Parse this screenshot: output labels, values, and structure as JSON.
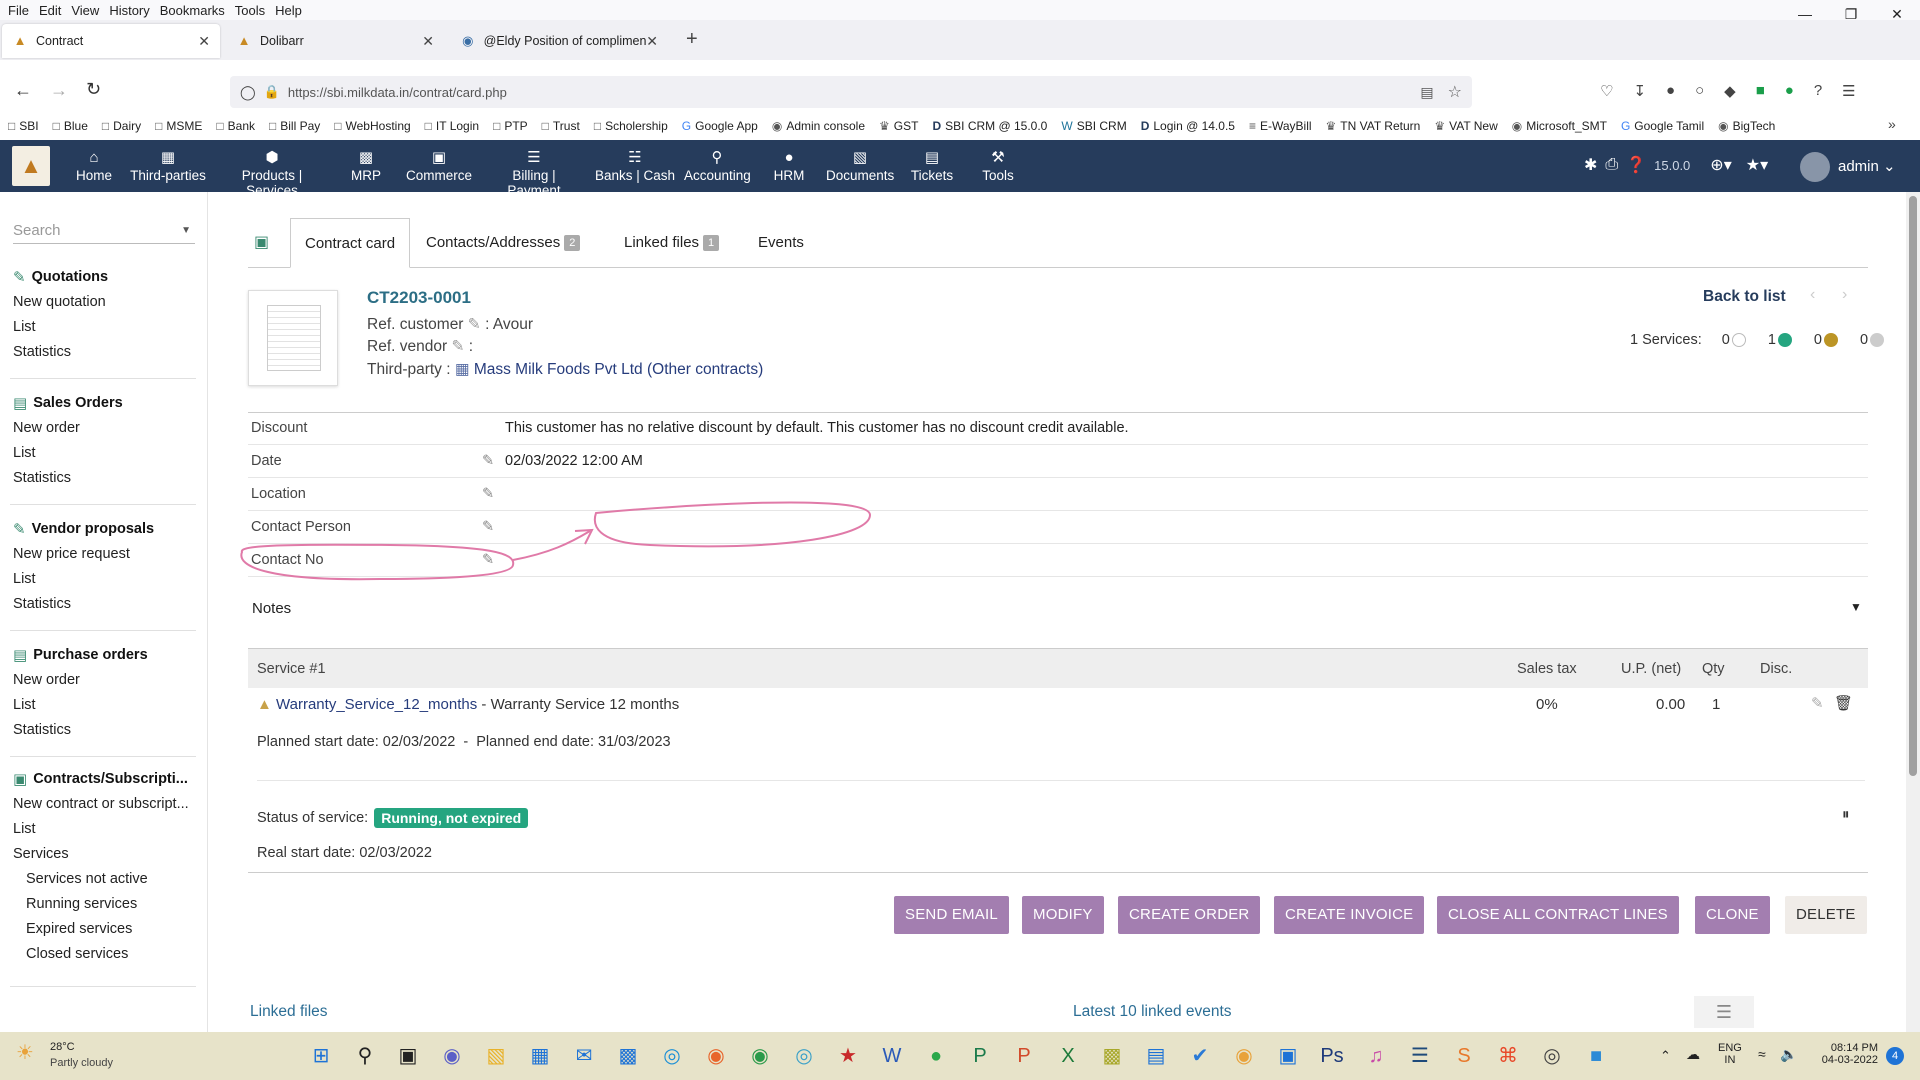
{
  "browser": {
    "menu": [
      "File",
      "Edit",
      "View",
      "History",
      "Bookmarks",
      "Tools",
      "Help"
    ],
    "tabs": [
      {
        "title": "Contract",
        "active": true
      },
      {
        "title": "Dolibarr",
        "active": false
      },
      {
        "title": "@Eldy Position of compliment",
        "active": false
      }
    ],
    "url": "https://sbi.milkdata.in/contrat/card.php",
    "bookmarks": [
      "SBI",
      "Blue",
      "Dairy",
      "MSME",
      "Bank",
      "Bill Pay",
      "WebHosting",
      "IT Login",
      "PTP",
      "Trust",
      "Scholership",
      "Google App",
      "Admin console",
      "GST",
      "SBI CRM @ 15.0.0",
      "SBI CRM",
      "Login @ 14.0.5",
      "E-WayBill",
      "TN VAT Return",
      "VAT New",
      "Microsoft_SMT",
      "Google Tamil",
      "BigTech"
    ]
  },
  "topmenu": [
    {
      "label": "Home",
      "icon": "home-icon"
    },
    {
      "label": "Third-parties",
      "icon": "building-icon"
    },
    {
      "label": "Products | Services",
      "icon": "cube-icon"
    },
    {
      "label": "MRP",
      "icon": "cubes-icon"
    },
    {
      "label": "Commerce",
      "icon": "suitcase-icon",
      "active": true
    },
    {
      "label": "Billing | Payment",
      "icon": "money-icon"
    },
    {
      "label": "Banks | Cash",
      "icon": "bank-icon"
    },
    {
      "label": "Accounting",
      "icon": "search-dollar-icon"
    },
    {
      "label": "HRM",
      "icon": "user-tie-icon"
    },
    {
      "label": "Documents",
      "icon": "folder-open-icon"
    },
    {
      "label": "Tickets",
      "icon": "ticket-icon"
    },
    {
      "label": "Tools",
      "icon": "wrench-icon"
    }
  ],
  "topright": {
    "version": "15.0.0",
    "user": "admin"
  },
  "leftmenu": {
    "search_placeholder": "Search",
    "sections": [
      {
        "title": "Quotations",
        "items": [
          "New quotation",
          "List",
          "Statistics"
        ]
      },
      {
        "title": "Sales Orders",
        "items": [
          "New order",
          "List",
          "Statistics"
        ]
      },
      {
        "title": "Vendor proposals",
        "items": [
          "New price request",
          "List",
          "Statistics"
        ]
      },
      {
        "title": "Purchase orders",
        "items": [
          "New order",
          "List",
          "Statistics"
        ]
      },
      {
        "title": "Contracts/Subscripti...",
        "items": [
          "New contract or subscript...",
          "List",
          "Services"
        ],
        "subitems": [
          "Services not active",
          "Running services",
          "Expired services",
          "Closed services"
        ]
      }
    ]
  },
  "cardtabs": [
    {
      "label": "Contract card",
      "active": true
    },
    {
      "label": "Contacts/Addresses",
      "badge": "2"
    },
    {
      "label": "Linked files",
      "badge": "1"
    },
    {
      "label": "Events"
    }
  ],
  "contract": {
    "ref": "CT2203-0001",
    "ref_customer_label": "Ref. customer",
    "ref_customer_value": ": Avour",
    "ref_vendor_label": "Ref. vendor",
    "ref_vendor_value": ":",
    "thirdparty_label": "Third-party :",
    "thirdparty_name": "Mass Milk Foods Pvt Ltd",
    "thirdparty_extra": "(Other contracts)",
    "back_to_list": "Back to list",
    "services_label": "1 Services:",
    "services_counts": [
      "0",
      "1",
      "0",
      "0"
    ],
    "status_colors": [
      "#ffffff",
      "#25a580",
      "#bc9526",
      "#cccccc"
    ]
  },
  "fields": [
    {
      "label": "Discount",
      "value": "This customer has no relative discount by default. This customer has no discount credit available."
    },
    {
      "label": "Date",
      "value": "02/03/2022 12:00 AM"
    },
    {
      "label": "Location",
      "value": ""
    },
    {
      "label": "Contact Person",
      "value": ""
    },
    {
      "label": "Contact No",
      "value": ""
    }
  ],
  "notes_label": "Notes",
  "service": {
    "header": [
      "Service #1",
      "Sales tax",
      "U.P. (net)",
      "Qty",
      "Disc."
    ],
    "product": "Warranty_Service_12_months",
    "description": "- Warranty Service 12 months",
    "tax": "0%",
    "up": "0.00",
    "qty": "1",
    "planned": "Planned start date: 02/03/2022  -  Planned end date: 31/03/2023",
    "status_label": "Status of service:",
    "status_value": "Running, not expired",
    "real_start": "Real start date: 02/03/2022"
  },
  "actions": [
    "SEND EMAIL",
    "MODIFY",
    "CREATE ORDER",
    "CREATE INVOICE",
    "CLOSE ALL CONTRACT LINES",
    "CLONE",
    "DELETE"
  ],
  "footer": {
    "linked_files": "Linked files",
    "latest_events": "Latest 10 linked events"
  },
  "taskbar": {
    "weather_temp": "28°C",
    "weather_desc": "Partly cloudy",
    "lang": "ENG",
    "region": "IN",
    "time": "08:14 PM",
    "date": "04-03-2022",
    "notif": "4"
  }
}
